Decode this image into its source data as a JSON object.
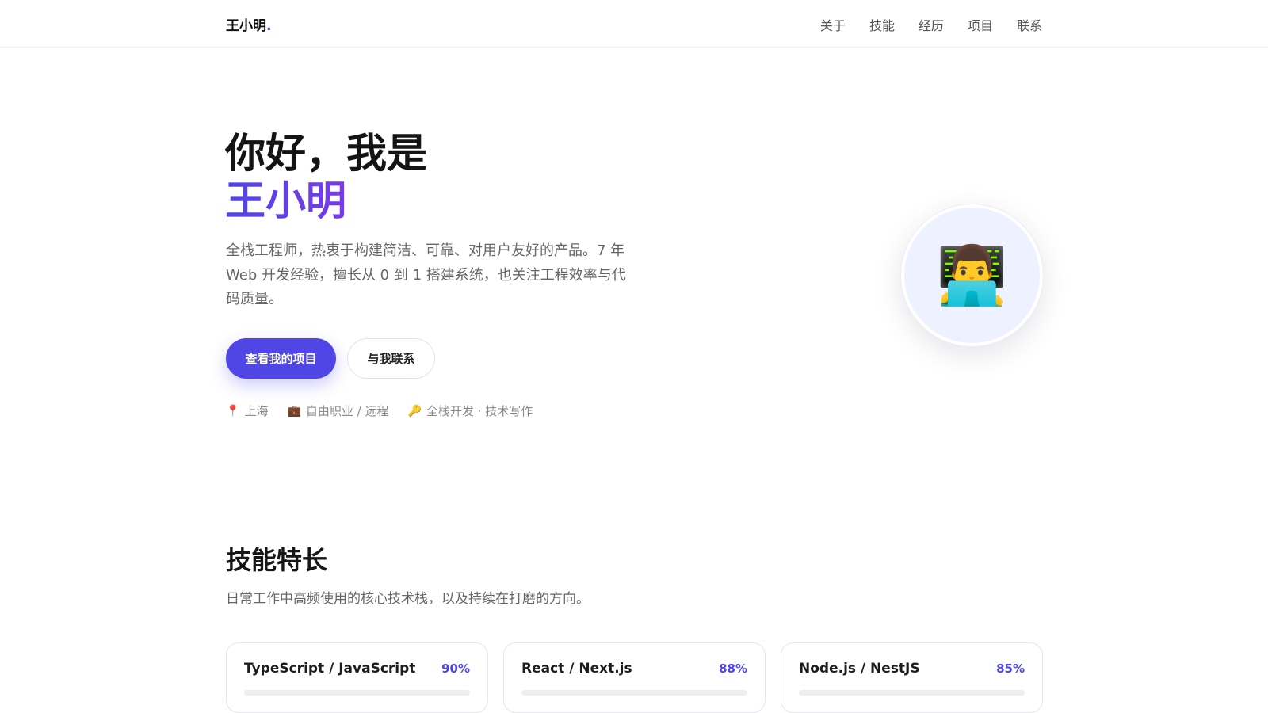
{
  "header": {
    "brand": "王小明",
    "brand_dot": ".",
    "nav": [
      "关于",
      "技能",
      "经历",
      "项目",
      "联系"
    ]
  },
  "hero": {
    "greeting": "你好，我是",
    "name": "王小明",
    "description": "全栈工程师，热衷于构建简洁、可靠、对用户友好的产品。7 年 Web 开发经验，擅长从 0 到 1 搭建系统，也关注工程效率与代码质量。",
    "primary_button": "查看我的项目",
    "secondary_button": "与我联系",
    "meta": [
      {
        "icon": "📍",
        "icon_name": "location-pin-icon",
        "text": "上海"
      },
      {
        "icon": "💼",
        "icon_name": "briefcase-icon",
        "text": "自由职业 / 远程"
      },
      {
        "icon": "🔑",
        "icon_name": "key-icon",
        "text": "全栈开发 · 技术写作"
      }
    ],
    "avatar": {
      "icon": "👨‍💻",
      "icon_name": "technologist-icon"
    }
  },
  "skills": {
    "title": "技能特长",
    "subtitle": "日常工作中高频使用的核心技术栈，以及持续在打磨的方向。",
    "items": [
      {
        "name": "TypeScript / JavaScript",
        "percent_label": "90%",
        "level": 0.9
      },
      {
        "name": "React / Next.js",
        "percent_label": "88%",
        "level": 0.88
      },
      {
        "name": "Node.js / NestJS",
        "percent_label": "85%",
        "level": 0.85
      }
    ]
  },
  "colors": {
    "accent": "#4f46e5",
    "accent_gradient_end": "#9333ea",
    "avatar_bg": "#eef1ff"
  }
}
